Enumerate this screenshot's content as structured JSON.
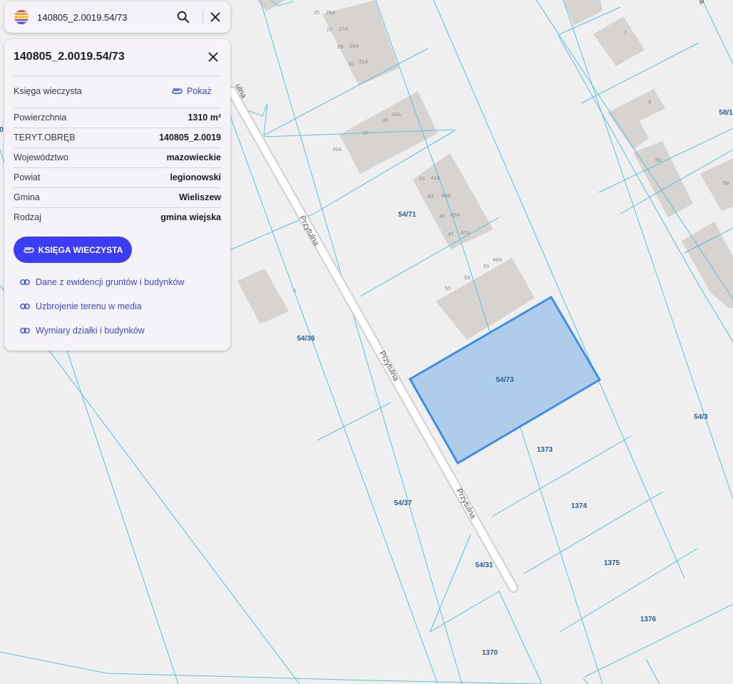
{
  "search": {
    "value": "140805_2.0019.54/73"
  },
  "panel": {
    "title": "140805_2.0019.54/73",
    "ksiega_label": "Księga wieczysta",
    "ksiega_link": "Pokaż",
    "rows": [
      {
        "label": "Powierzchnia",
        "value": "1310 m²"
      },
      {
        "label": "TERYT.OBRĘB",
        "value": "140805_2.0019"
      },
      {
        "label": "Województwo",
        "value": "mazowieckie"
      },
      {
        "label": "Powiat",
        "value": "legionowski"
      },
      {
        "label": "Gmina",
        "value": "Wieliszew"
      },
      {
        "label": "Rodzaj",
        "value": "gmina wiejska"
      }
    ],
    "button_label": "KSIĘGA WIECZYSTA",
    "links": [
      "Dane z ewidencji gruntów i budynków",
      "Uzbrojenie terenu w media",
      "Wymiary działki i budynków"
    ]
  },
  "map": {
    "colors": {
      "background": "#efefef",
      "parcel_line": "#5cc0da",
      "building": "#d6d3d0",
      "highlight_fill": "#a9c9ea",
      "highlight_stroke": "#3f8fe0",
      "parcel_label": "#2a5f8c"
    },
    "street_labels": [
      "Przytulna",
      "Przytulna",
      "Przytulna",
      "ulna",
      "a"
    ],
    "parcel_labels": [
      "54/73",
      "54/71",
      "54/36",
      "54/37",
      "54/31",
      "54/3",
      "1373",
      "1374",
      "1375",
      "1376",
      "1370",
      "58/1",
      "0"
    ],
    "building_numbers": [
      "25",
      "25A",
      "27",
      "27A",
      "29",
      "29A",
      "31",
      "31A",
      "35",
      "33A",
      "37",
      "39A",
      "41",
      "41A",
      "43",
      "43A",
      "45",
      "45A",
      "47",
      "47A",
      "49A",
      "51",
      "53",
      "55",
      "7",
      "5",
      "5b",
      "5a",
      "6"
    ]
  }
}
